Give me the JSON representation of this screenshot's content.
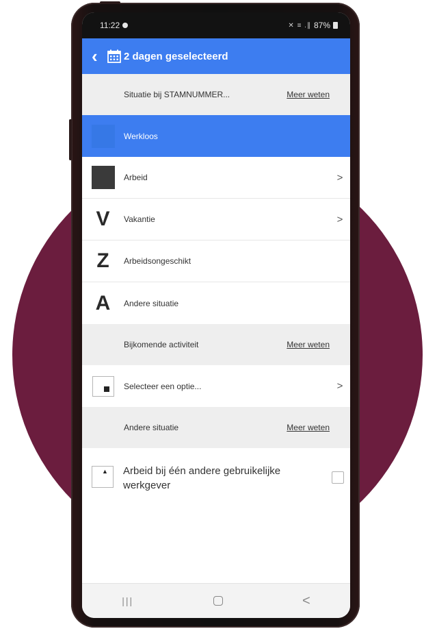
{
  "colors": {
    "accent": "#3d7df0",
    "background_circle": "#6b1d3e"
  },
  "status_bar": {
    "time": "11:22",
    "signal": "✕ ≡ .∥",
    "battery": "87%"
  },
  "app_bar": {
    "back_icon": "back-chevron-icon",
    "calendar_icon": "calendar-icon",
    "title": "2 dagen geselecteerd"
  },
  "section_situation": {
    "label": "Situatie bij STAMNUMMER...",
    "link": "Meer weten"
  },
  "situations": [
    {
      "icon": "blue-square-icon",
      "label": "Werkloos",
      "selected": true,
      "chevron": ""
    },
    {
      "icon": "dark-square-icon",
      "label": "Arbeid",
      "selected": false,
      "chevron": ">"
    },
    {
      "icon": "V",
      "label": "Vakantie",
      "selected": false,
      "chevron": ">"
    },
    {
      "icon": "Z",
      "label": "Arbeidsongeschikt",
      "selected": false,
      "chevron": ""
    },
    {
      "icon": "A",
      "label": "Andere situatie",
      "selected": false,
      "chevron": ""
    }
  ],
  "section_activity": {
    "label": "Bijkomende activiteit",
    "link": "Meer weten"
  },
  "activity_select": {
    "placeholder": "Selecteer een optie...",
    "chevron": ">"
  },
  "section_other": {
    "label": "Andere situatie",
    "link": "Meer weten"
  },
  "other_option": {
    "label": "Arbeid bij één andere gebruikelijke werkgever",
    "checked": false
  },
  "nav_bar": {
    "recent": "|||",
    "back": "<"
  }
}
